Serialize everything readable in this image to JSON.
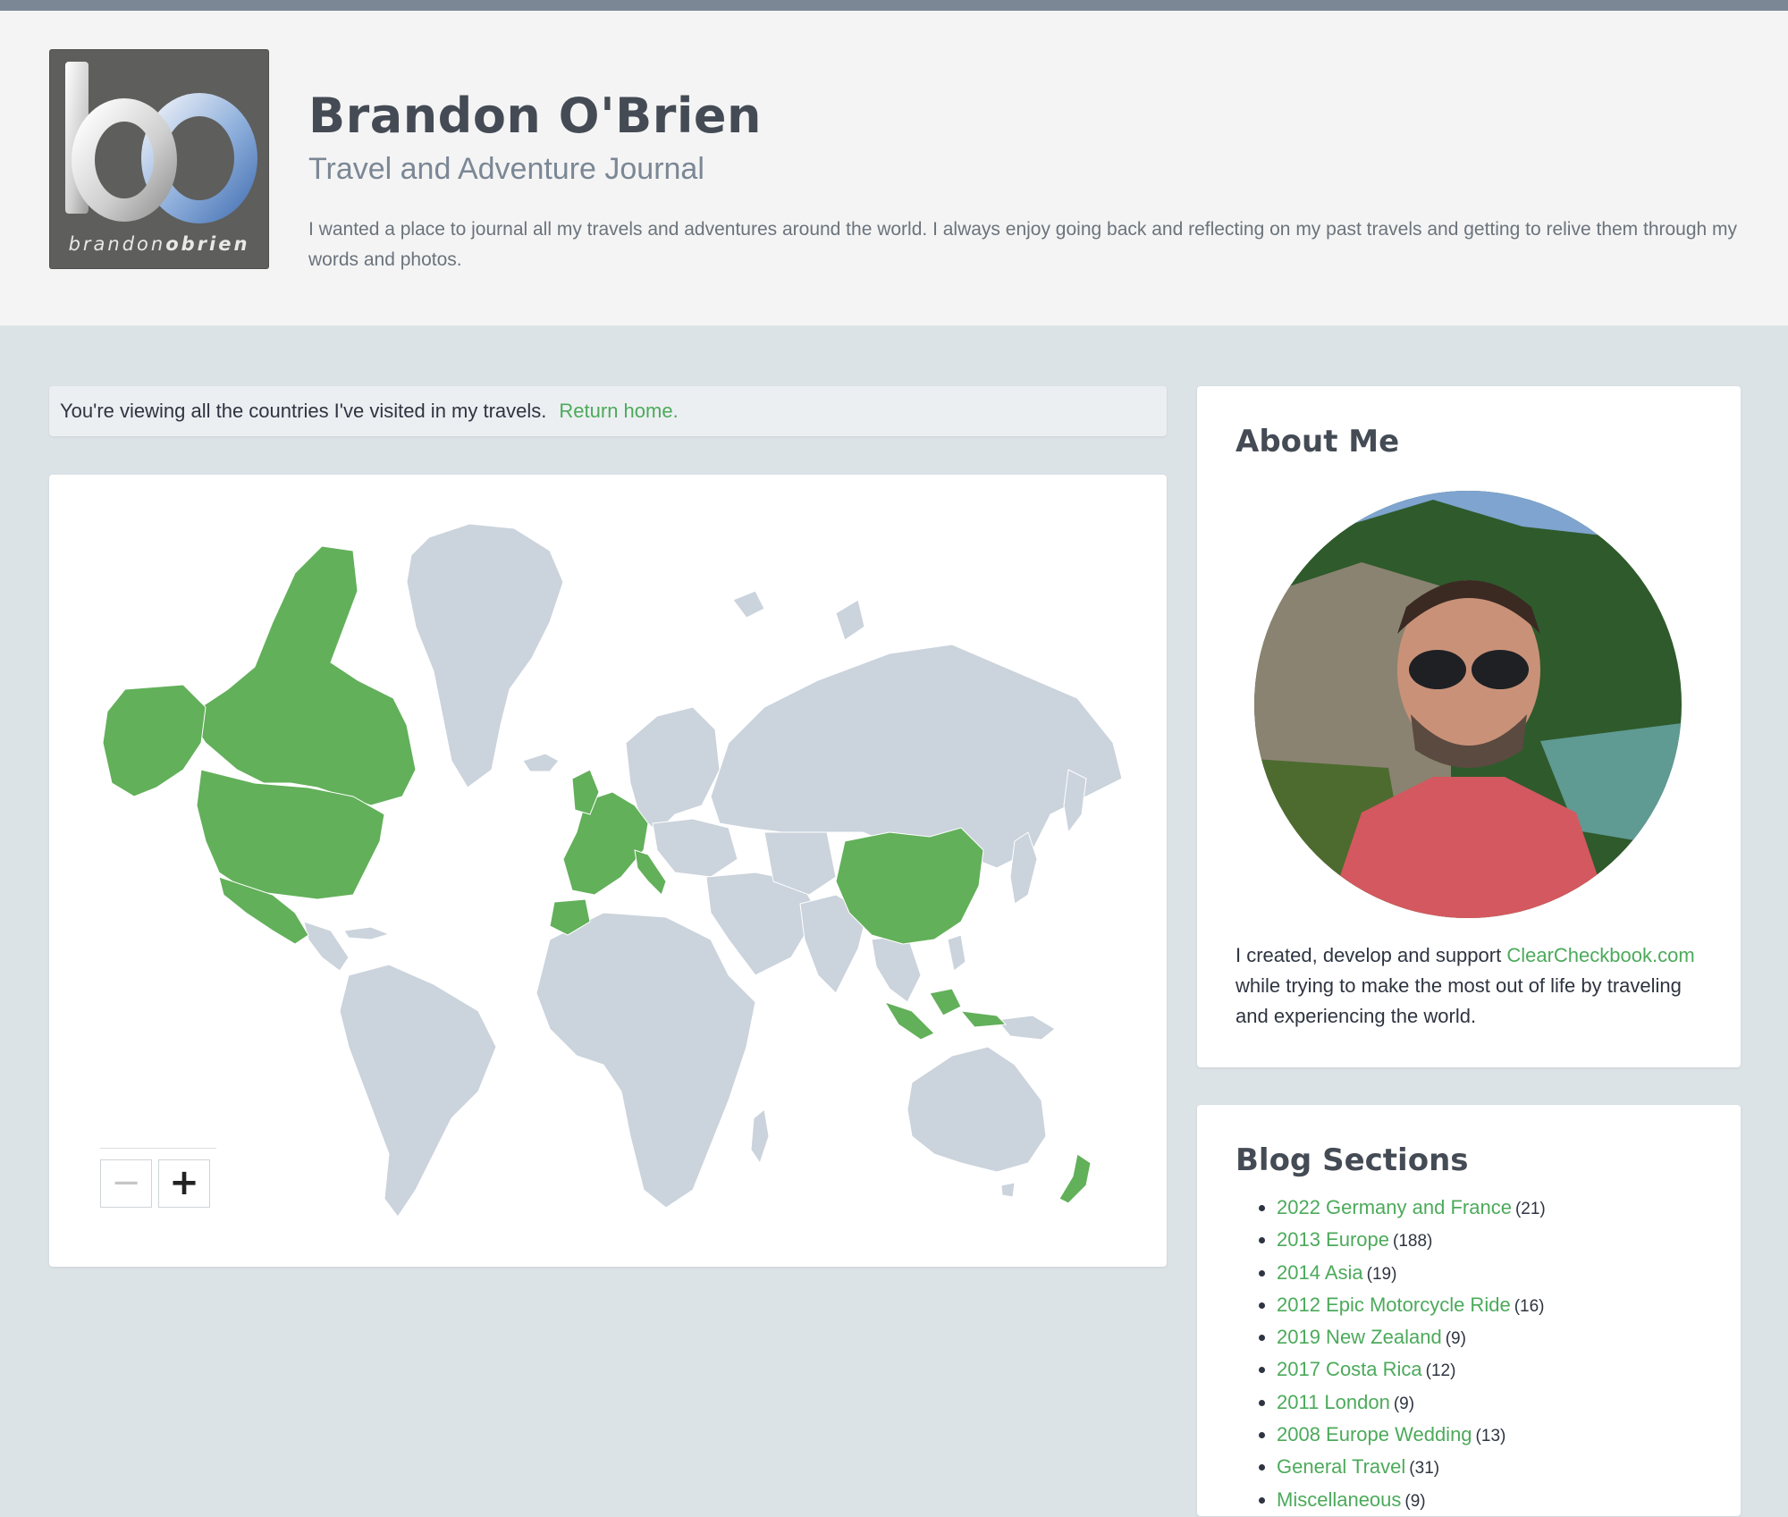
{
  "header": {
    "logo_caption_light": "brandon",
    "logo_caption_bold": "obrien",
    "title": "Brandon O'Brien",
    "subtitle": "Travel and Adventure Journal",
    "description": "I wanted a place to journal all my travels and adventures around the world. I always enjoy going back and reflecting on my past travels and getting to relive them through my words and photos."
  },
  "notice": {
    "text": "You're viewing all the countries I've visited in my travels.",
    "link": "Return home."
  },
  "map": {
    "visited_color": "#62b05a",
    "unvisited_color": "#cbd3dc",
    "zoom_out_label": "−",
    "zoom_in_label": "+",
    "visited_regions": [
      "Canada",
      "United States",
      "Mexico",
      "United Kingdom",
      "Ireland",
      "France",
      "Spain",
      "Portugal",
      "Germany",
      "Netherlands",
      "Belgium",
      "Switzerland",
      "Italy",
      "Morocco",
      "China",
      "Indonesia",
      "New Zealand"
    ]
  },
  "about": {
    "heading": "About Me",
    "text_before": "I created, develop and support ",
    "link": "ClearCheckbook.com",
    "text_after": " while trying to make the most out of life by traveling and experiencing the world."
  },
  "blog": {
    "heading": "Blog Sections",
    "sections": [
      {
        "label": "2022 Germany and France",
        "count": "(21)"
      },
      {
        "label": "2013 Europe",
        "count": "(188)"
      },
      {
        "label": "2014 Asia",
        "count": "(19)"
      },
      {
        "label": "2012 Epic Motorcycle Ride",
        "count": "(16)"
      },
      {
        "label": "2019 New Zealand",
        "count": "(9)"
      },
      {
        "label": "2017 Costa Rica",
        "count": "(12)"
      },
      {
        "label": "2011 London",
        "count": "(9)"
      },
      {
        "label": "2008 Europe Wedding",
        "count": "(13)"
      },
      {
        "label": "General Travel",
        "count": "(31)"
      },
      {
        "label": "Miscellaneous",
        "count": "(9)"
      }
    ]
  },
  "colors": {
    "accent_link": "#4caa5b",
    "header_bg": "#f4f4f4",
    "page_bg": "#dce3e7"
  }
}
